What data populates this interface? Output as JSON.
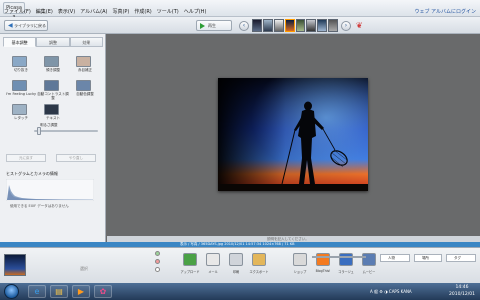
{
  "menubar": {
    "logo": "Picasa 3",
    "items": [
      "ファイル(F)",
      "編集(E)",
      "表示(V)",
      "アルバム(A)",
      "写真(P)",
      "作成(R)",
      "ツール(T)",
      "ヘルプ(H)"
    ],
    "web_album_link": "ウェブ アルバムにログイン"
  },
  "toolbar": {
    "back_label": "ライブラリに戻る",
    "play_label": "再生",
    "prev_icon": "arrow-left-icon",
    "next_icon": "arrow-right-icon"
  },
  "left_panel": {
    "tabs": [
      "基本調整",
      "調整",
      "効果"
    ],
    "active_tab": 0,
    "tools": [
      {
        "label": "切り抜き",
        "icon": "crop-icon",
        "color": "#8aa8c6"
      },
      {
        "label": "傾き調整",
        "icon": "straighten-icon",
        "color": "#7f95a8"
      },
      {
        "label": "赤目補正",
        "icon": "redeye-icon",
        "color": "#c9b1a1"
      },
      {
        "label": "I'm Feeling Lucky",
        "icon": "lucky-icon",
        "color": "#6f8fb2"
      },
      {
        "label": "自動コントラスト調整",
        "icon": "auto-contrast-icon",
        "color": "#5f7898"
      },
      {
        "label": "自動色調整",
        "icon": "auto-color-icon",
        "color": "#6b86a9"
      },
      {
        "label": "レタッチ",
        "icon": "retouch-icon",
        "color": "#9eb2c4"
      },
      {
        "label": "テキスト",
        "icon": "text-icon",
        "color": "#2c3748"
      }
    ],
    "slider_label": "明るさ調整",
    "slider_value": 0.05,
    "undo_label": "元に戻す",
    "redo_label": "やり直し",
    "histogram_title": "ヒストグラムとカメラの情報",
    "camera_info": "使用できる EXIF データはありません"
  },
  "viewer": {
    "caption_placeholder": "説明を記入してください。"
  },
  "status": {
    "text": "表示 / 写真 / 365DAYS.jpg 2010/12/01 14:57:34 1024×768 / 71 KB"
  },
  "tray": {
    "label": "選択",
    "buttons": [
      {
        "label": "アップロード",
        "icon": "upload-icon",
        "color": "#4aa146"
      },
      {
        "label": "メール",
        "icon": "email-icon",
        "color": "#e8e8e8"
      },
      {
        "label": "印刷",
        "icon": "print-icon",
        "color": "#d0d4da"
      },
      {
        "label": "エクスポート",
        "icon": "export-icon",
        "color": "#e3b65a"
      }
    ],
    "buttons2": [
      {
        "label": "ショップ",
        "icon": "shop-icon",
        "color": "#d9d9d9"
      },
      {
        "label": "BlogThis!",
        "icon": "blogger-icon",
        "color": "#f47a20"
      },
      {
        "label": "コラージュ",
        "icon": "collage-icon",
        "color": "#3a6ec0"
      },
      {
        "label": "ムービー",
        "icon": "movie-icon",
        "color": "#5b7db3"
      }
    ],
    "people_label": "人物",
    "place_label": "場所",
    "tag_label": "タグ"
  },
  "taskbar": {
    "apps": [
      {
        "icon": "ie-icon",
        "glyph": "e",
        "color": "#3a9be8"
      },
      {
        "icon": "explorer-icon",
        "glyph": "▤",
        "color": "#f1c24b"
      },
      {
        "icon": "media-player-icon",
        "glyph": "▶",
        "color": "#ff9a1f"
      },
      {
        "icon": "picasa-icon",
        "glyph": "✿",
        "color": "#e64d8a"
      }
    ],
    "systray": "A 般 ⚙ ◑ CAPS KANA",
    "time": "14:46",
    "date": "2010/12/01"
  }
}
